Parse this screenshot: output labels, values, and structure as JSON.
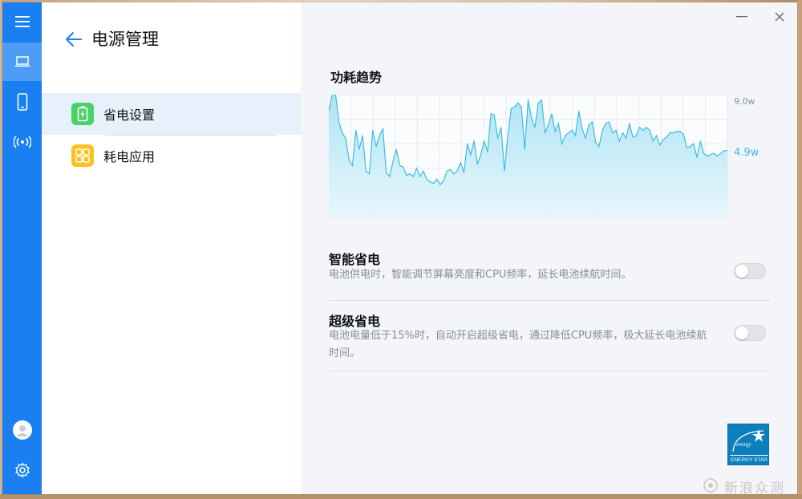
{
  "colors": {
    "rail": "#1a7ff0",
    "accent": "#1a7ff0",
    "chart_line": "#3cbde0",
    "chart_fill": "#c9eef8",
    "battery_icon_bg": "#4cd06a",
    "apps_icon_bg": "#ffc11f"
  },
  "rail": {
    "items": [
      {
        "icon": "menu-icon"
      },
      {
        "icon": "laptop-icon",
        "active": true
      },
      {
        "icon": "phone-icon"
      },
      {
        "icon": "wireless-icon"
      },
      {
        "icon": "avatar-icon"
      },
      {
        "icon": "gear-icon"
      }
    ]
  },
  "left": {
    "title": "电源管理",
    "nav": [
      {
        "label": "省电设置",
        "icon": "battery-icon",
        "active": true
      },
      {
        "label": "耗电应用",
        "icon": "apps-grid-icon",
        "active": false
      }
    ]
  },
  "main": {
    "chart_title": "功耗趋势",
    "max_label": "9.0w",
    "current_label": "4.9w",
    "settings": [
      {
        "title": "智能省电",
        "desc": "电池供电时，智能调节屏幕亮度和CPU频率，延长电池续航时间。",
        "enabled": false
      },
      {
        "title": "超级省电",
        "desc": "电池电量低于15%时，自动开启超级省电，通过降低CPU频率，极大延长电池续航时间。",
        "enabled": false
      }
    ],
    "badge": {
      "text": "ENERGY STAR",
      "script": "energy"
    }
  },
  "watermark": "新浪众测",
  "chart_data": {
    "type": "area",
    "title": "功耗趋势",
    "ylim": [
      0,
      9.0
    ],
    "tick_labels": [
      "9.0w"
    ],
    "current_value_label": "4.9w",
    "grid": true,
    "values": [
      7.8,
      9.0,
      9.0,
      7.0,
      6.2,
      5.8,
      4.2,
      3.8,
      6.4,
      5.0,
      6.0,
      3.4,
      3.2,
      6.4,
      5.2,
      6.0,
      6.5,
      3.3,
      3.0,
      4.1,
      5.0,
      3.8,
      3.7,
      3.1,
      3.2,
      3.0,
      3.6,
      3.0,
      3.4,
      2.8,
      2.6,
      2.5,
      2.8,
      2.4,
      2.7,
      3.4,
      3.5,
      3.2,
      3.4,
      4.0,
      3.3,
      5.4,
      4.6,
      5.6,
      3.9,
      4.6,
      5.6,
      4.8,
      7.6,
      7.5,
      5.8,
      6.6,
      3.4,
      6.0,
      8.0,
      8.1,
      8.4,
      8.1,
      5.0,
      8.6,
      7.3,
      6.6,
      8.4,
      8.6,
      6.2,
      6.8,
      7.6,
      6.3,
      6.9,
      5.4,
      6.0,
      6.2,
      6.4,
      6.0,
      7.8,
      6.5,
      5.8,
      6.8,
      7.0,
      5.5,
      5.2,
      6.4,
      6.9,
      7.0,
      6.2,
      6.4,
      5.6,
      6.2,
      5.8,
      6.9,
      5.9,
      6.0,
      6.6,
      6.4,
      6.6,
      6.4,
      5.6,
      6.0,
      5.3,
      5.7,
      5.9,
      6.2,
      6.2,
      6.3,
      6.3,
      6.1,
      5.1,
      5.2,
      5.4,
      4.4,
      5.6,
      4.7,
      4.5,
      4.6,
      4.7,
      4.5,
      4.7,
      4.9,
      4.9
    ]
  }
}
